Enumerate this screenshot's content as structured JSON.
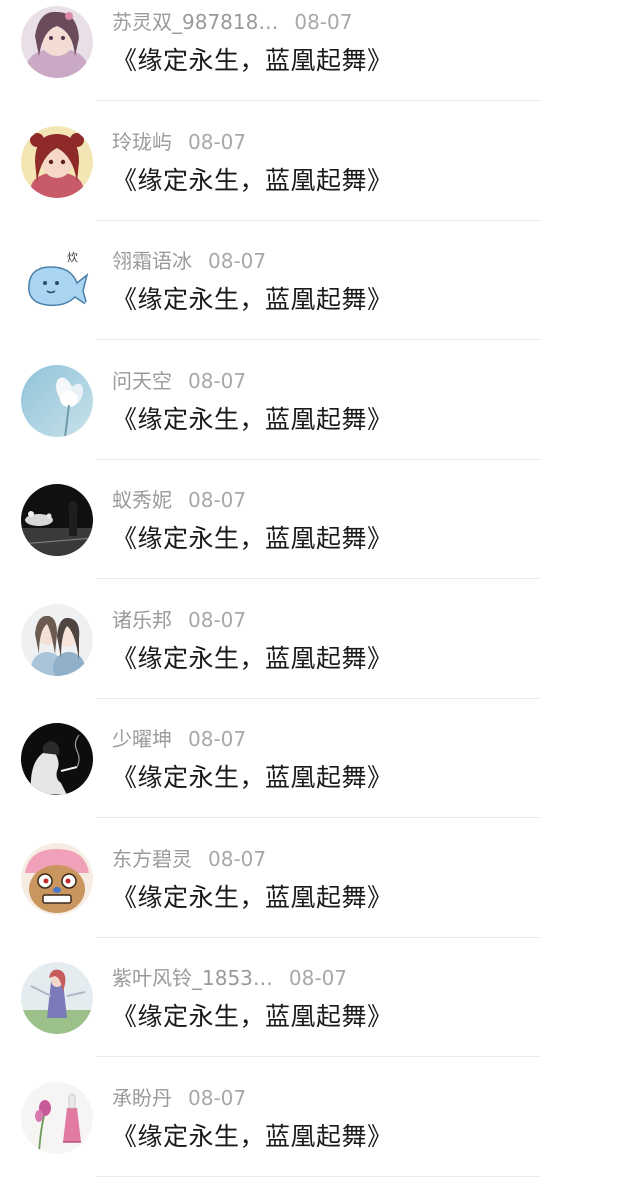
{
  "comments": [
    {
      "user": "苏灵双_987818…",
      "date": "08-07",
      "text": "《缘定永生，蓝凰起舞》",
      "avatar": "anime-girl-avatar"
    },
    {
      "user": "玲珑屿",
      "date": "08-07",
      "text": "《缘定永生，蓝凰起舞》",
      "avatar": "anime-girl-red-avatar"
    },
    {
      "user": "翎霜语冰",
      "date": "08-07",
      "text": "《缘定永生，蓝凰起舞》",
      "avatar": "cartoon-whale-avatar"
    },
    {
      "user": "问天空",
      "date": "08-07",
      "text": "《缘定永生，蓝凰起舞》",
      "avatar": "lotus-flower-avatar"
    },
    {
      "user": "蚁秀妮",
      "date": "08-07",
      "text": "《缘定永生，蓝凰起舞》",
      "avatar": "night-street-avatar"
    },
    {
      "user": "诸乐邦",
      "date": "08-07",
      "text": "《缘定永生，蓝凰起舞》",
      "avatar": "anime-couple-avatar"
    },
    {
      "user": "少曜坤",
      "date": "08-07",
      "text": "《缘定永生，蓝凰起舞》",
      "avatar": "smoking-silhouette-avatar"
    },
    {
      "user": "东方碧灵",
      "date": "08-07",
      "text": "《缘定永生，蓝凰起舞》",
      "avatar": "pink-cartoon-avatar"
    },
    {
      "user": "紫叶风铃_1853…",
      "date": "08-07",
      "text": "《缘定永生，蓝凰起舞》",
      "avatar": "fantasy-warrior-avatar"
    },
    {
      "user": "承盼丹",
      "date": "08-07",
      "text": "《缘定永生，蓝凰起舞》",
      "avatar": "flower-dress-avatar"
    }
  ]
}
